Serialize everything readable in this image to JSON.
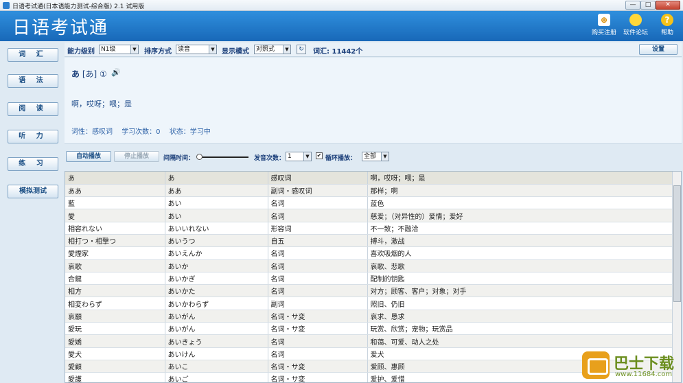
{
  "window": {
    "title": "日语考试通(日本语能力测试-综合版) 2.1 试用版",
    "min_label": "—",
    "max_label": "□",
    "close_label": "✕"
  },
  "header": {
    "app_title": "日语考试通",
    "buttons": [
      {
        "label": "购买注册",
        "icon": "register-icon"
      },
      {
        "label": "软件论坛",
        "icon": "forum-bulb-icon"
      },
      {
        "label": "帮助",
        "icon": "help-icon"
      }
    ]
  },
  "sidebar": {
    "items": [
      {
        "label": "词 汇"
      },
      {
        "label": "语 法"
      },
      {
        "label": "阅 读"
      },
      {
        "label": "听 力"
      },
      {
        "label": "练 习"
      },
      {
        "label": "模拟测试"
      }
    ]
  },
  "toolbar": {
    "level_label": "能力级别",
    "level_value": "N1级",
    "sort_label": "排序方式",
    "sort_value": "读音",
    "display_label": "显示模式",
    "display_value": "对照式",
    "vocab_count": "词汇: 11442个",
    "settings_label": "设置"
  },
  "detail": {
    "word": "あ",
    "reading": "[あ] ①",
    "meaning": "啊，哎呀；喂；是",
    "pos": "词性：感叹词",
    "study_count": "学习次数：0",
    "status": "状态：学习中"
  },
  "playback": {
    "auto_play_label": "自动播放",
    "stop_play_label": "停止播放",
    "interval_label": "间隔时间：",
    "repeat_label": "发音次数：",
    "repeat_value": "1",
    "loop_check": "✔",
    "loop_label": "循环播放：",
    "loop_value": "全部"
  },
  "table": {
    "rows": [
      [
        "あ",
        "あ",
        "感叹词",
        "啊，哎呀；喂；是"
      ],
      [
        "ああ",
        "ああ",
        "副词・感叹词",
        "那样；啊"
      ],
      [
        "藍",
        "あい",
        "名词",
        "蓝色"
      ],
      [
        "愛",
        "あい",
        "名词",
        "慈爱；（对异性的）爱情；爱好"
      ],
      [
        "相容れない",
        "あいいれない",
        "形容词",
        "不一致；不融洽"
      ],
      [
        "相打つ・相撃つ",
        "あいうつ",
        "自五",
        "搏斗，激战"
      ],
      [
        "愛煙家",
        "あいえんか",
        "名词",
        "喜欢吸烟的人"
      ],
      [
        "哀歌",
        "あいか",
        "名词",
        "哀歌、悲歌"
      ],
      [
        "合鍵",
        "あいかぎ",
        "名词",
        "配制的钥匙"
      ],
      [
        "相方",
        "あいかた",
        "名词",
        "对方；顾客、客户；对象；对手"
      ],
      [
        "相変わらず",
        "あいかわらず",
        "副词",
        "照旧、仍旧"
      ],
      [
        "哀願",
        "あいがん",
        "名词・サ変",
        "哀求、恳求"
      ],
      [
        "愛玩",
        "あいがん",
        "名词・サ変",
        "玩赏、欣赏；宠物；玩赏品"
      ],
      [
        "愛嬌",
        "あいきょう",
        "名词",
        "和蔼、可爱、动人之处"
      ],
      [
        "愛犬",
        "あいけん",
        "名词",
        "爱犬"
      ],
      [
        "愛顧",
        "あいこ",
        "名词・サ変",
        "爱顾、惠顾"
      ],
      [
        "愛護",
        "あいご",
        "名词・サ変",
        "爱护、爱惜"
      ]
    ]
  },
  "watermark": {
    "brand": "巴士下载",
    "url": "www.11684.com"
  }
}
